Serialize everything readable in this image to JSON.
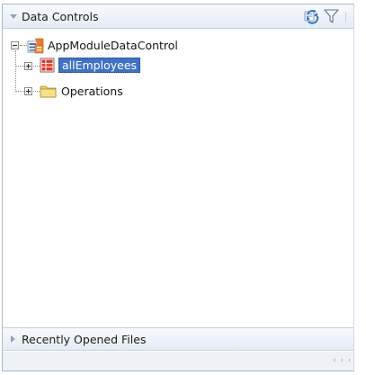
{
  "panel": {
    "title": "Data Controls",
    "toolbar": {
      "refresh_icon": "refresh-icon",
      "filter_icon": "filter-icon"
    }
  },
  "tree": {
    "root": {
      "label": "AppModuleDataControl",
      "icon": "data-control-icon",
      "expanded": true,
      "children": [
        {
          "label": "allEmployees",
          "icon": "collection-icon",
          "expanded": false,
          "selected": true
        },
        {
          "label": "Operations",
          "icon": "folder-icon",
          "expanded": false,
          "selected": false
        }
      ]
    }
  },
  "recent_files": {
    "title": "Recently Opened Files",
    "expanded": false
  },
  "statusbar": {
    "grip": "‹ ‹ ‹"
  },
  "colors": {
    "selection": "#3f72c6",
    "header_border": "#a9b8cc",
    "collection_red": "#d8342b",
    "folder_yellow": "#f0d060"
  }
}
